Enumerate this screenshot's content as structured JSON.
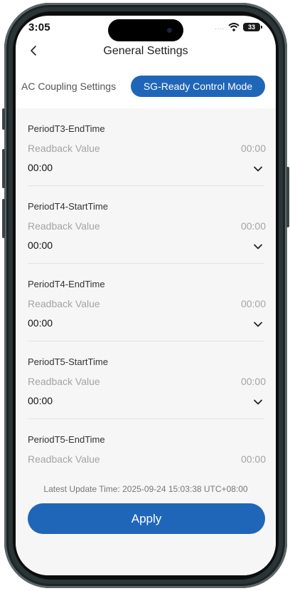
{
  "status_bar": {
    "time": "3:05",
    "signal_dots": "....",
    "battery": "33"
  },
  "header": {
    "title": "General Settings"
  },
  "tabs": [
    {
      "label": "AC Coupling Settings",
      "active": false
    },
    {
      "label": "SG-Ready Control Mode",
      "active": true
    }
  ],
  "items": [
    {
      "title": "PeriodT3-EndTime",
      "readback_label": "Readback Value",
      "readback_value": "00:00",
      "selected": "00:00"
    },
    {
      "title": "PeriodT4-StartTime",
      "readback_label": "Readback Value",
      "readback_value": "00:00",
      "selected": "00:00"
    },
    {
      "title": "PeriodT4-EndTime",
      "readback_label": "Readback Value",
      "readback_value": "00:00",
      "selected": "00:00"
    },
    {
      "title": "PeriodT5-StartTime",
      "readback_label": "Readback Value",
      "readback_value": "00:00",
      "selected": "00:00"
    },
    {
      "title": "PeriodT5-EndTime",
      "readback_label": "Readback Value",
      "readback_value": "00:00"
    }
  ],
  "footer": {
    "latest_update": "Latest Update Time: 2025-09-24 15:03:38 UTC+08:00",
    "apply_label": "Apply"
  },
  "colors": {
    "accent": "#2066b8",
    "background": "#f6f6f6"
  }
}
